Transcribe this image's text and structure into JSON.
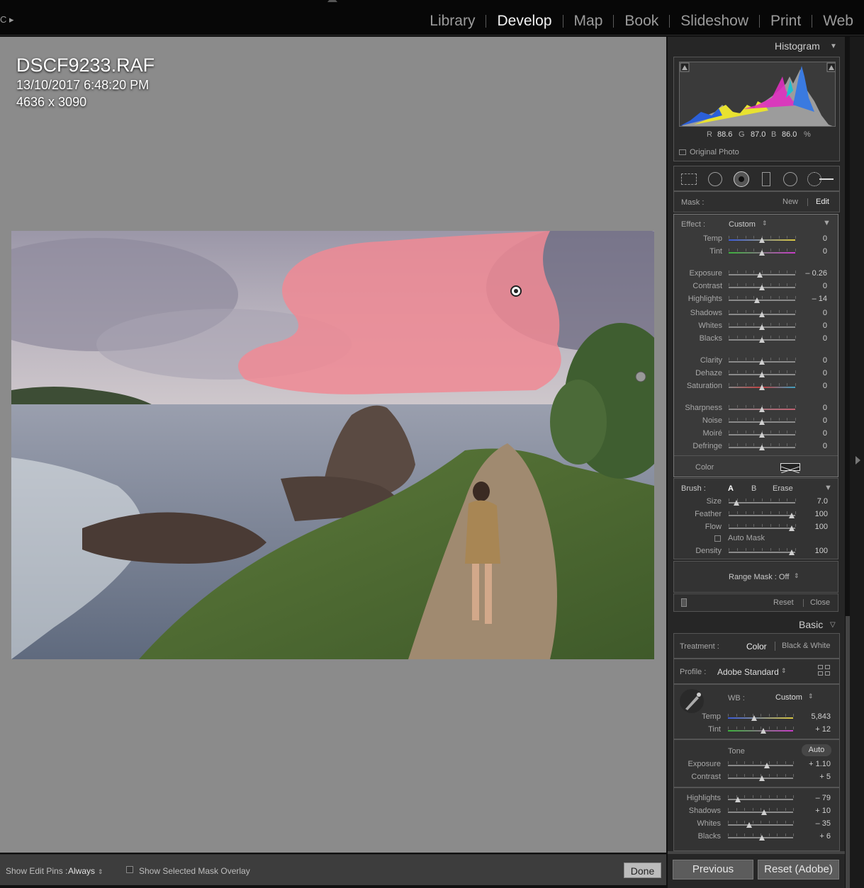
{
  "topbar": {
    "left_label": "C ▸",
    "modules": [
      "Library",
      "Develop",
      "Map",
      "Book",
      "Slideshow",
      "Print",
      "Web"
    ],
    "active_module": "Develop"
  },
  "photo_info": {
    "filename": "DSCF9233.RAF",
    "datetime": "13/10/2017 6:48:20 PM",
    "dimensions": "4636 x 3090"
  },
  "toolbar": {
    "show_edit_pins_label": "Show Edit Pins :",
    "show_edit_pins_value": "Always",
    "overlay_label": "Show Selected Mask Overlay",
    "done": "Done"
  },
  "histogram": {
    "title": "Histogram",
    "r_label": "R",
    "r": "88.6",
    "g_label": "G",
    "g": "87.0",
    "b_label": "B",
    "b": "86.0",
    "pct": "%",
    "original_photo": "Original Photo"
  },
  "mask": {
    "label": "Mask :",
    "new": "New",
    "edit": "Edit"
  },
  "effect": {
    "label": "Effect :",
    "preset": "Custom",
    "sliders": [
      {
        "name": "Temp",
        "value": "0",
        "pos": 0.5
      },
      {
        "name": "Tint",
        "value": "0",
        "pos": 0.5
      },
      {
        "name": "Exposure",
        "value": "– 0.26",
        "pos": 0.47
      },
      {
        "name": "Contrast",
        "value": "0",
        "pos": 0.5
      },
      {
        "name": "Highlights",
        "value": "– 14",
        "pos": 0.43
      },
      {
        "name": "Shadows",
        "value": "0",
        "pos": 0.5
      },
      {
        "name": "Whites",
        "value": "0",
        "pos": 0.5
      },
      {
        "name": "Blacks",
        "value": "0",
        "pos": 0.5
      },
      {
        "name": "Clarity",
        "value": "0",
        "pos": 0.5
      },
      {
        "name": "Dehaze",
        "value": "0",
        "pos": 0.5
      },
      {
        "name": "Saturation",
        "value": "0",
        "pos": 0.5
      },
      {
        "name": "Sharpness",
        "value": "0",
        "pos": 0.5
      },
      {
        "name": "Noise",
        "value": "0",
        "pos": 0.5
      },
      {
        "name": "Moiré",
        "value": "0",
        "pos": 0.5
      },
      {
        "name": "Defringe",
        "value": "0",
        "pos": 0.5
      }
    ],
    "color_label": "Color"
  },
  "brush": {
    "label": "Brush :",
    "a": "A",
    "b": "B",
    "erase": "Erase",
    "sliders": [
      {
        "name": "Size",
        "value": "7.0",
        "pos": 0.12
      },
      {
        "name": "Feather",
        "value": "100",
        "pos": 0.95
      },
      {
        "name": "Flow",
        "value": "100",
        "pos": 0.95
      },
      {
        "name": "Density",
        "value": "100",
        "pos": 0.95
      }
    ],
    "auto_mask": "Auto Mask",
    "range_mask": "Range Mask : Off",
    "reset": "Reset",
    "close": "Close"
  },
  "basic": {
    "title": "Basic",
    "treatment_label": "Treatment :",
    "color": "Color",
    "bw": "Black & White",
    "profile_label": "Profile :",
    "profile": "Adobe Standard",
    "wb_label": "WB :",
    "wb": "Custom",
    "wb_sliders": [
      {
        "name": "Temp",
        "value": "5,843",
        "pos": 0.4
      },
      {
        "name": "Tint",
        "value": "+ 12",
        "pos": 0.54
      }
    ],
    "tone_label": "Tone",
    "auto": "Auto",
    "tone_sliders": [
      {
        "name": "Exposure",
        "value": "+ 1.10",
        "pos": 0.6
      },
      {
        "name": "Contrast",
        "value": "+ 5",
        "pos": 0.52
      }
    ],
    "presence_sliders": [
      {
        "name": "Highlights",
        "value": "– 79",
        "pos": 0.15
      },
      {
        "name": "Shadows",
        "value": "+ 10",
        "pos": 0.55
      },
      {
        "name": "Whites",
        "value": "– 35",
        "pos": 0.33
      },
      {
        "name": "Blacks",
        "value": "+ 6",
        "pos": 0.52
      }
    ]
  },
  "nav": {
    "previous": "Previous",
    "reset": "Reset (Adobe)"
  }
}
